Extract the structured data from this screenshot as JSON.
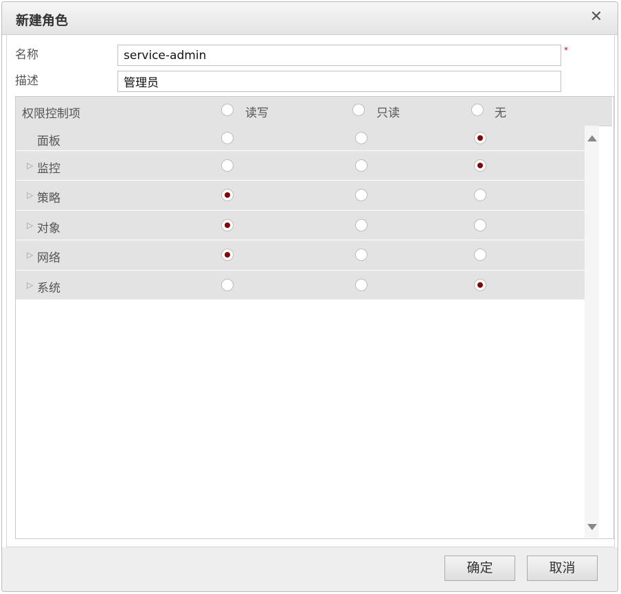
{
  "dialog": {
    "title": "新建角色",
    "close_symbol": "✕"
  },
  "form": {
    "name_label": "名称",
    "name_value": "service-admin",
    "required_mark": "*",
    "desc_label": "描述",
    "desc_value": "管理员"
  },
  "permissions": {
    "header": "权限控制项",
    "columns": [
      "读写",
      "只读",
      "无"
    ],
    "rows": [
      {
        "label": "面板",
        "expandable": false,
        "selected": "无"
      },
      {
        "label": "监控",
        "expandable": true,
        "selected": "无"
      },
      {
        "label": "策略",
        "expandable": true,
        "selected": "读写"
      },
      {
        "label": "对象",
        "expandable": true,
        "selected": "读写"
      },
      {
        "label": "网络",
        "expandable": true,
        "selected": "读写"
      },
      {
        "label": "系统",
        "expandable": true,
        "selected": "无"
      }
    ],
    "expand_symbol": "▷"
  },
  "footer": {
    "ok_label": "确定",
    "cancel_label": "取消"
  },
  "colors": {
    "selected_dot": "#8b0000",
    "required": "#d00000"
  }
}
